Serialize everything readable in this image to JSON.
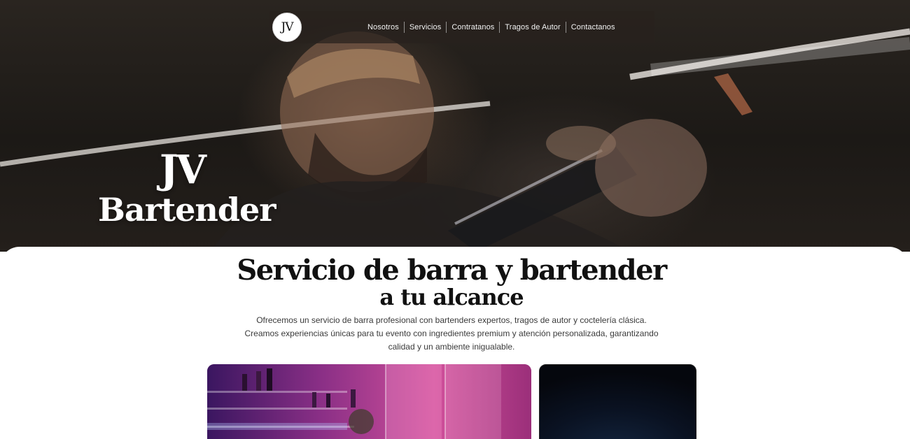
{
  "header": {
    "logo_text": "JV",
    "nav": [
      "Nosotros",
      "Servicios",
      "Contratanos",
      "Tragos de Autor",
      "Contactanos"
    ]
  },
  "hero": {
    "title_line1": "JV",
    "title_line2": "Bartender"
  },
  "main": {
    "heading": "Servicio de barra y bartender",
    "subheading": "a tu alcance",
    "description": [
      "Ofrecemos un servicio de barra profesional con bartenders expertos, tragos de autor y coctelería clásica.",
      "Creamos experiencias únicas para tu evento con ingredientes premium y atención personalizada, garantizando",
      "calidad y un ambiente inigualable."
    ]
  },
  "colors": {
    "hero_bg": "#1c1916",
    "card_pink": "#c0408f",
    "card_dark": "#0a1222"
  }
}
